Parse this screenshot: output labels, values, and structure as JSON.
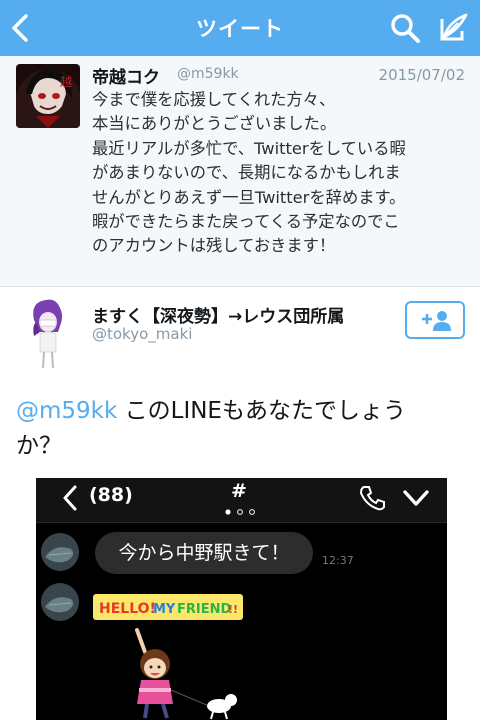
{
  "nav": {
    "title": "ツイート",
    "bg_color": "#55acee",
    "icons": [
      "chevron-left-icon",
      "search-icon",
      "compose-icon"
    ]
  },
  "tweet1": {
    "name": "帝越コク",
    "handle": "@m59kk",
    "date": "2015/07/02",
    "body_lines": [
      "今まで僕を応援してくれた方々、",
      "本当にありがとうございました。",
      "最近リアルが多忙で、Twitterをしている暇",
      "があまりないので、長期になるかもしれま",
      "せんがとりあえず一旦Twitterを辞めます。",
      "暇ができたらまた戻ってくる予定なのでこ",
      "のアカウントは残しておきます！"
    ]
  },
  "tweet2": {
    "name": "ますく【深夜勢】→レウス団所属",
    "handle": "@tokyo_maki",
    "mention": "@m59kk",
    "text_rest": " このLINEもあなたでしょう",
    "text_line2": "か？",
    "follow_icon": "add-user-icon"
  },
  "line_screenshot": {
    "back_count": "(88)",
    "title": "#",
    "message": "今から中野駅きて！",
    "message_time": "12:37",
    "sticker_text": [
      "HELLO!",
      "MY",
      "FRIEND",
      "!!"
    ]
  }
}
